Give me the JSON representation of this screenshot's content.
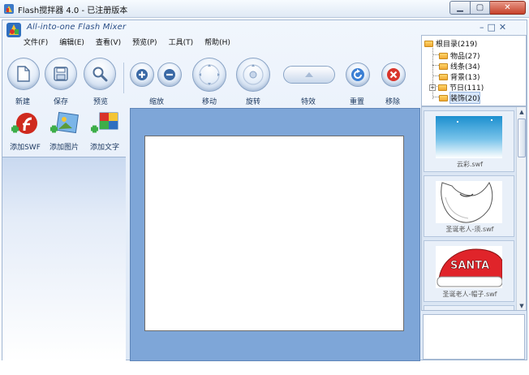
{
  "os_window": {
    "title": "Flash搅拌器 4.0 - 已注册版本",
    "buttons": {
      "minimize": "▁",
      "maximize": "▢",
      "close": "✕"
    }
  },
  "app": {
    "title": "All-into-one Flash Mixer",
    "window_controls": [
      "–",
      "□",
      "✕"
    ],
    "menu": [
      "文件(F)",
      "编辑(E)",
      "查看(V)",
      "预览(P)",
      "工具(T)",
      "帮助(H)"
    ]
  },
  "toolbar": {
    "new": "新建",
    "save": "保存",
    "preview": "预览",
    "zoom": "缩放",
    "move": "移动",
    "rotate": "旋转",
    "effects": "特效",
    "reset": "重置",
    "remove": "移除"
  },
  "tree": {
    "root": "根目录(219)",
    "items": [
      "物品(27)",
      "线条(34)",
      "背景(13)",
      "节日(111)",
      "装饰(20)"
    ]
  },
  "adders": {
    "swf": "添加SWF",
    "image": "添加图片",
    "text": "添加文字"
  },
  "thumbnails": [
    {
      "caption": "云彩.swf"
    },
    {
      "caption": "圣诞老人-须.swf"
    },
    {
      "caption": "圣诞老人-帽子.swf",
      "text": "SANTA"
    }
  ],
  "colors": {
    "accent": "#2a4e86",
    "stage": "#7ea6d8",
    "remove": "#d9342b",
    "reset": "#3b7fd4"
  }
}
